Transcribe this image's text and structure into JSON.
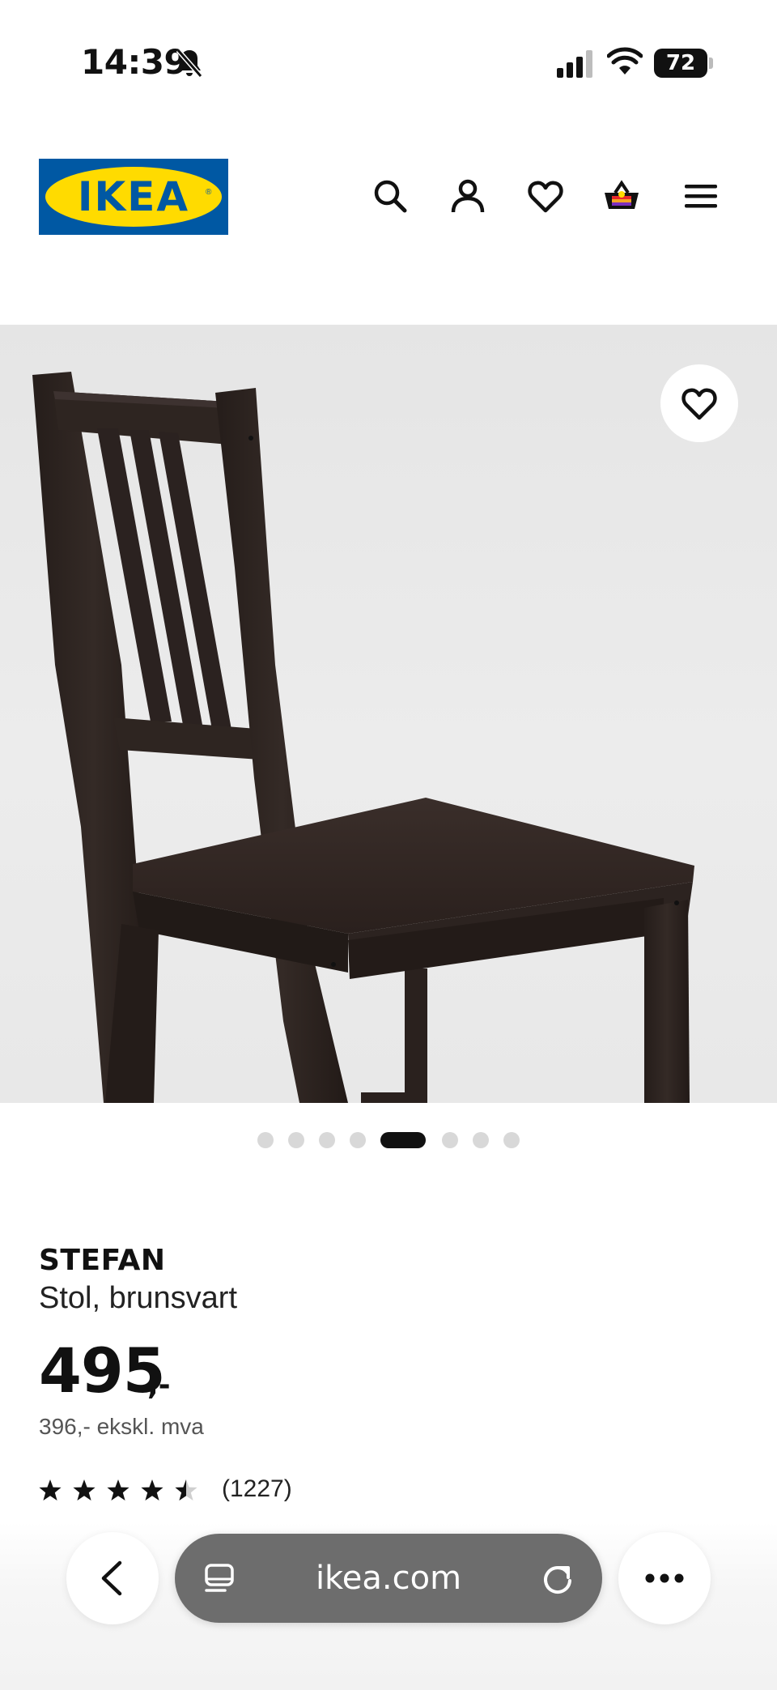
{
  "status_bar": {
    "time": "14:39",
    "battery_level": "72",
    "bell_icon": "bell-slash-icon",
    "signal_icon": "cellular-signal-icon",
    "wifi_icon": "wifi-icon"
  },
  "header": {
    "logo_text": "IKEA",
    "icons": [
      "search-icon",
      "account-icon",
      "favorites-icon",
      "cart-icon",
      "menu-icon"
    ]
  },
  "gallery": {
    "image_alt": "STEFAN chair, brown-black",
    "favorite_icon": "heart-icon",
    "total_images": 8,
    "active_index": 5
  },
  "product": {
    "name": "STEFAN",
    "description": "Stol, brunsvart",
    "price_main": "495",
    "price_suffix": ",-",
    "price_ex_vat": "396,- ekskl. mva",
    "rating_value": 4.5,
    "rating_max": 5,
    "rating_count": "(1227)"
  },
  "browser": {
    "url": "ikea.com",
    "back_icon": "chevron-left-icon",
    "tabs_icon": "reader-icon",
    "reload_icon": "reload-icon",
    "more_icon": "ellipsis-icon"
  },
  "colors": {
    "ikea_blue": "#0058a3",
    "ikea_yellow": "#ffdb00",
    "chair_brown_black": "#2e2521"
  }
}
